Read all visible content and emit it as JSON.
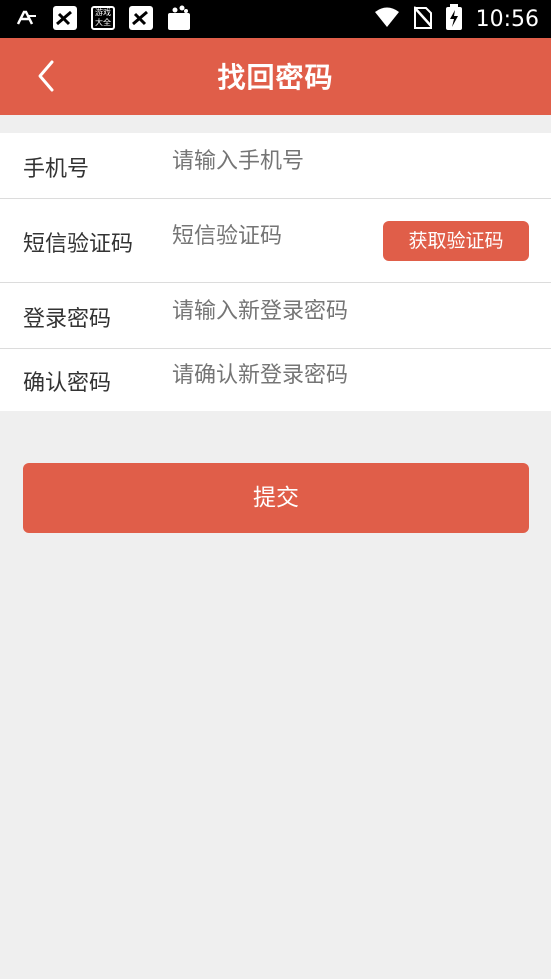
{
  "status_bar": {
    "time": "10:56",
    "icons": [
      "font-icon",
      "game-app-icon",
      "game-box-icon",
      "game-app-icon-2",
      "shopping-bag-icon",
      "wifi-icon",
      "no-sim-icon",
      "battery-charging-icon"
    ],
    "game_badge_text": "游戏大全"
  },
  "header": {
    "title": "找回密码",
    "back_icon": "chevron-left-icon",
    "color": "#e05e49"
  },
  "form": {
    "phone": {
      "label": "手机号",
      "placeholder": "请输入手机号"
    },
    "sms_code": {
      "label": "短信验证码",
      "placeholder": "短信验证码",
      "button": "获取验证码"
    },
    "password": {
      "label": "登录密码",
      "placeholder": "请输入新登录密码"
    },
    "confirm": {
      "label": "确认密码",
      "placeholder": "请确认新登录密码"
    }
  },
  "submit_label": "提交"
}
